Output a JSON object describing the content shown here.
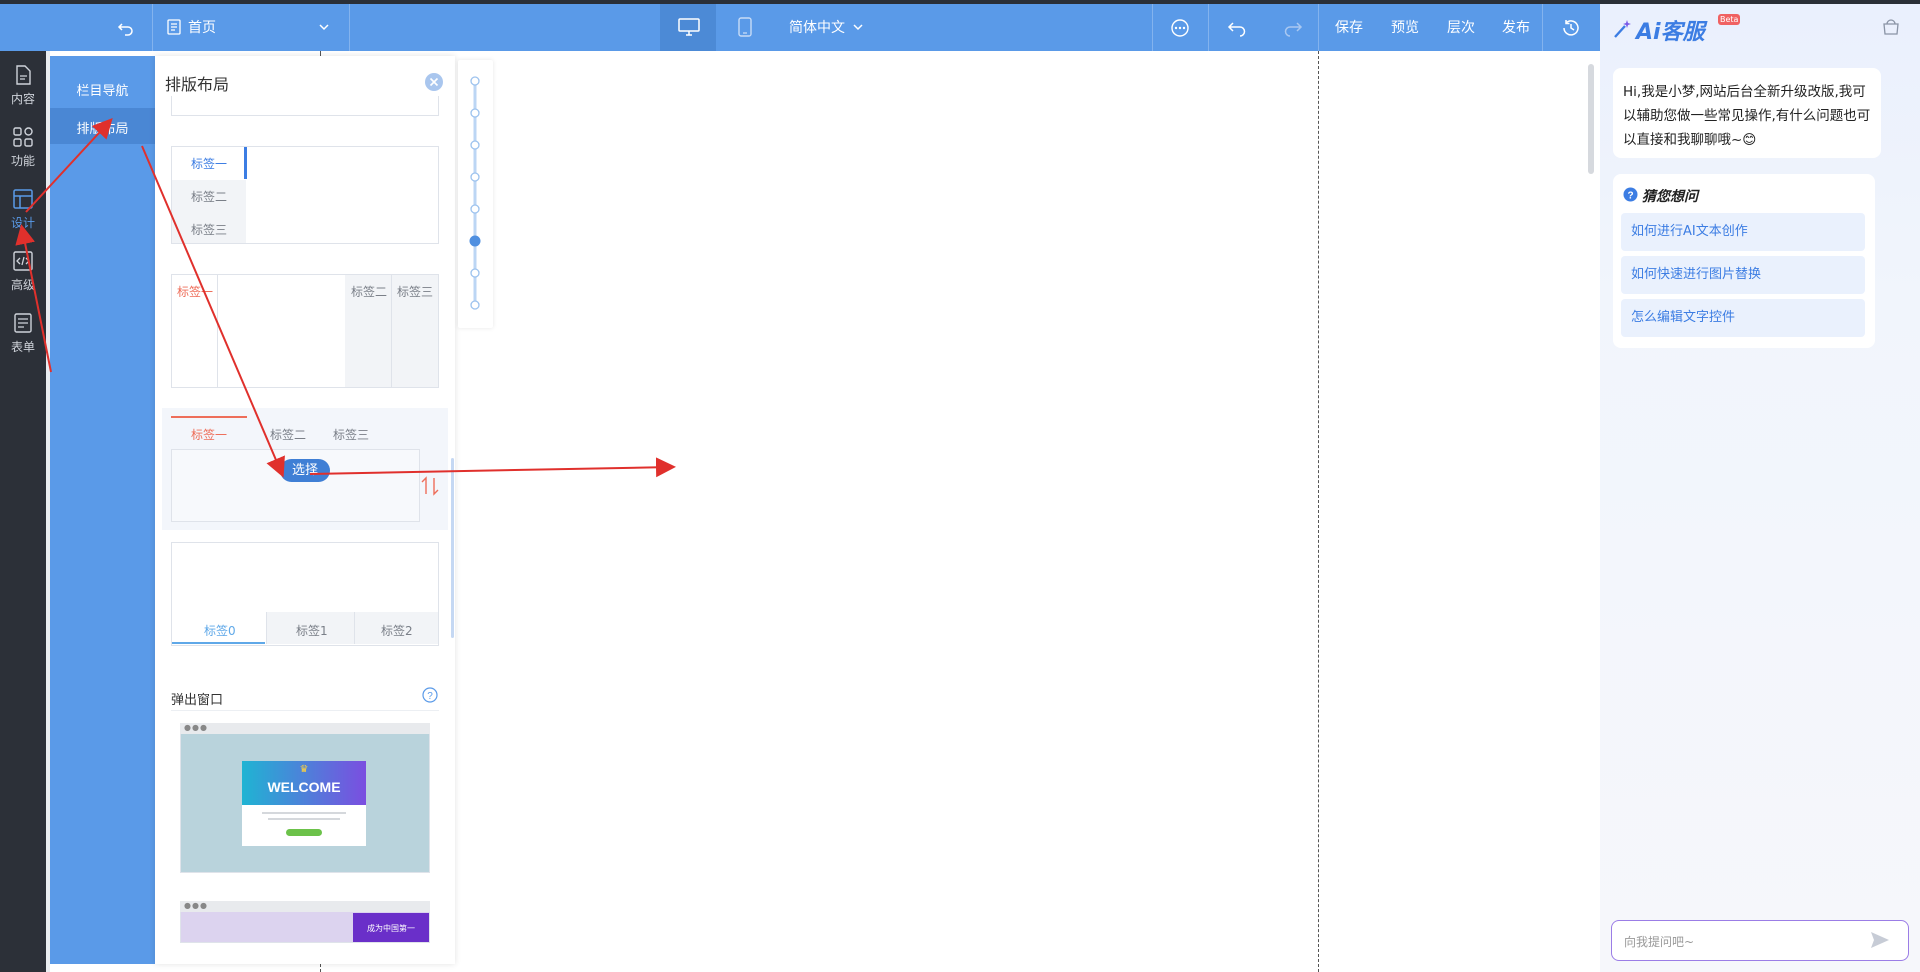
{
  "toolbar": {
    "page_name": "首页",
    "language": "简体中文",
    "save": "保存",
    "preview": "预览",
    "layers": "层次",
    "publish": "发布"
  },
  "left_nav": [
    {
      "label": "内容",
      "icon": "file-icon"
    },
    {
      "label": "功能",
      "icon": "grid-icon"
    },
    {
      "label": "设计",
      "icon": "layout-icon"
    },
    {
      "label": "高级",
      "icon": "code-icon"
    },
    {
      "label": "表单",
      "icon": "form-icon"
    }
  ],
  "sub_nav": {
    "items": [
      "栏目导航",
      "排版布局"
    ],
    "active": "排版布局"
  },
  "panel": {
    "title": "排版布局",
    "vtabs": [
      "标签一",
      "标签二",
      "标签三"
    ],
    "split_tabs": {
      "left": "标签一",
      "right": [
        "标签二",
        "标签三"
      ]
    },
    "htabs": [
      "标签一",
      "标签二",
      "标签三"
    ],
    "select_button": "选择",
    "btabs": [
      "标签0",
      "标签1",
      "标签2"
    ],
    "popup_section": "弹出窗口",
    "welcome": "WELCOME",
    "popup_thumb_text": "成为中国第一"
  },
  "ai": {
    "brand": "Ai客服",
    "badge": "Beta",
    "greeting": "Hi,我是小梦,网站后台全新升级改版,我可以辅助您做一些常见操作,有什么问题也可以直接和我聊聊哦~😊",
    "suggest_title": "猜您想问",
    "questions": [
      "如何进行AI文本创作",
      "如何快速进行图片替换",
      "怎么编辑文字控件"
    ],
    "input_placeholder": "向我提问吧~"
  },
  "colors": {
    "primary": "#5a9ae8",
    "accent_red": "#e74c3c",
    "sidebar_dark": "#2c3038"
  }
}
